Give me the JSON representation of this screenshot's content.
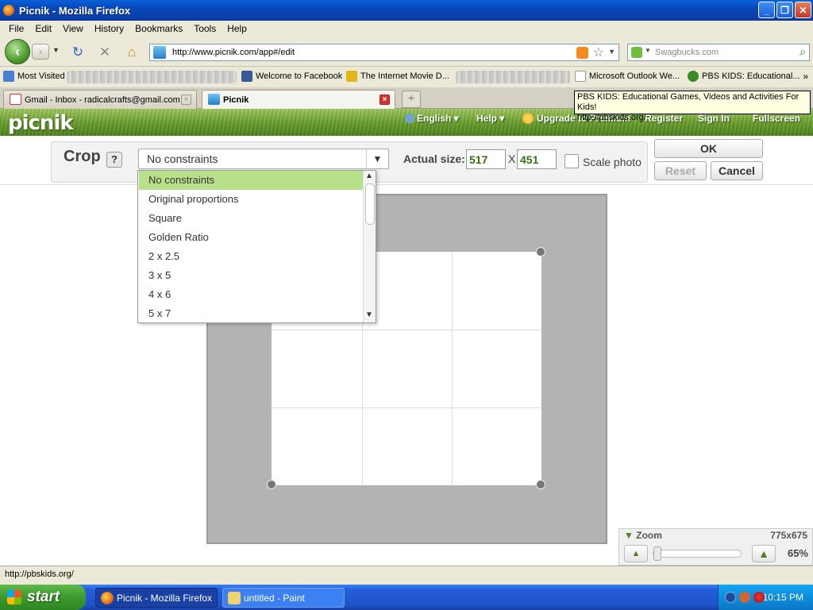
{
  "window": {
    "title": "Picnik - Mozilla Firefox"
  },
  "menu": [
    "File",
    "Edit",
    "View",
    "History",
    "Bookmarks",
    "Tools",
    "Help"
  ],
  "nav": {
    "url": "http://www.picnik.com/app#/edit",
    "search_placeholder": "Swagbucks.com"
  },
  "bookmarks": {
    "most_visited": "Most Visited",
    "facebook": "Welcome to Facebook",
    "imdb": "The Internet Movie D...",
    "outlook": "Microsoft Outlook We...",
    "pbskids": "PBS KIDS: Educational..."
  },
  "tabs": [
    {
      "label": "Gmail - Inbox - radicalcrafts@gmail.com"
    },
    {
      "label": "Picnik"
    }
  ],
  "tooltip": {
    "line1": "PBS KIDS: Educational Games, Videos and Activities For Kids!",
    "line2": "http://pbskids.org/"
  },
  "picnik": {
    "logo": "picnik",
    "nav": {
      "language": "English",
      "help": "Help",
      "upgrade": "Upgrade to Premium",
      "register": "Register",
      "signin": "Sign In",
      "fullscreen": "Fullscreen"
    }
  },
  "crop": {
    "label": "Crop",
    "help": "?",
    "constraint": "No constraints",
    "actual_size_label": "Actual size:",
    "width": "517",
    "height": "451",
    "x": "X",
    "scale_label": "Scale photo",
    "scale_checked": false,
    "ok": "OK",
    "reset": "Reset",
    "cancel": "Cancel",
    "options": [
      "No constraints",
      "Original proportions",
      "Square",
      "Golden Ratio",
      "2 x 2.5",
      "3 x 5",
      "4 x 6",
      "5 x 7"
    ],
    "selected_option": "No constraints"
  },
  "zoom": {
    "label": "Zoom",
    "dimensions": "775x675",
    "percent": "65%"
  },
  "status": "http://pbskids.org/",
  "taskbar": {
    "start": "start",
    "items": [
      {
        "label": "Picnik - Mozilla Firefox"
      },
      {
        "label": "untitled - Paint"
      }
    ],
    "clock": "10:15 PM"
  },
  "colors": {
    "accent": "#b8e08a",
    "xp_blue": "#245edb",
    "picnik_green": "#6a9f2e"
  }
}
